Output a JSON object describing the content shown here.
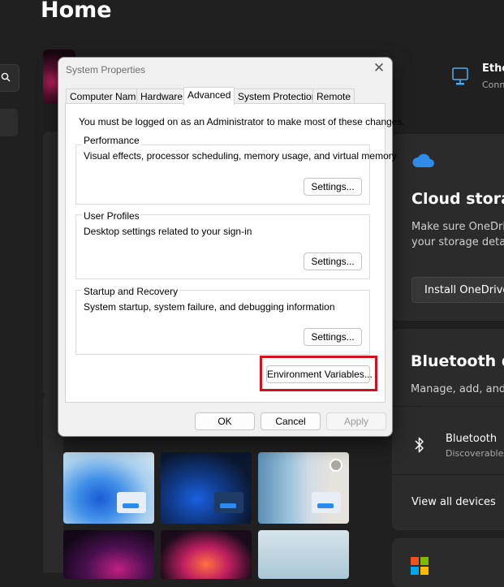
{
  "settings": {
    "page_title": "Home",
    "network": {
      "title": "Ethe",
      "subtitle": "Conn"
    },
    "cloud_storage": {
      "title": "Cloud storag",
      "desc_line1": "Make sure OneDriv",
      "desc_line2": "your storage detai",
      "button": "Install OneDrive"
    },
    "bluetooth": {
      "title": "Bluetooth de",
      "desc": "Manage, add, and",
      "device_name": "Bluetooth",
      "device_status": "Discoverable",
      "view_all": "View all devices"
    }
  },
  "dialog": {
    "title": "System Properties",
    "close": "✕",
    "tabs": [
      {
        "label": "Computer Name",
        "active": false
      },
      {
        "label": "Hardware",
        "active": false
      },
      {
        "label": "Advanced",
        "active": true
      },
      {
        "label": "System Protection",
        "active": false
      },
      {
        "label": "Remote",
        "active": false
      }
    ],
    "admin_note": "You must be logged on as an Administrator to make most of these changes.",
    "performance": {
      "legend": "Performance",
      "desc": "Visual effects, processor scheduling, memory usage, and virtual memory",
      "button": "Settings..."
    },
    "user_profiles": {
      "legend": "User Profiles",
      "desc": "Desktop settings related to your sign-in",
      "button": "Settings..."
    },
    "startup_recovery": {
      "legend": "Startup and Recovery",
      "desc": "System startup, system failure, and debugging information",
      "button": "Settings..."
    },
    "env_button": "Environment Variables...",
    "ok": "OK",
    "cancel": "Cancel",
    "apply": "Apply"
  },
  "colors": {
    "highlight": "#d4101c",
    "background": "#202020",
    "card": "#2b2b2b",
    "accent": "#0078d4"
  }
}
